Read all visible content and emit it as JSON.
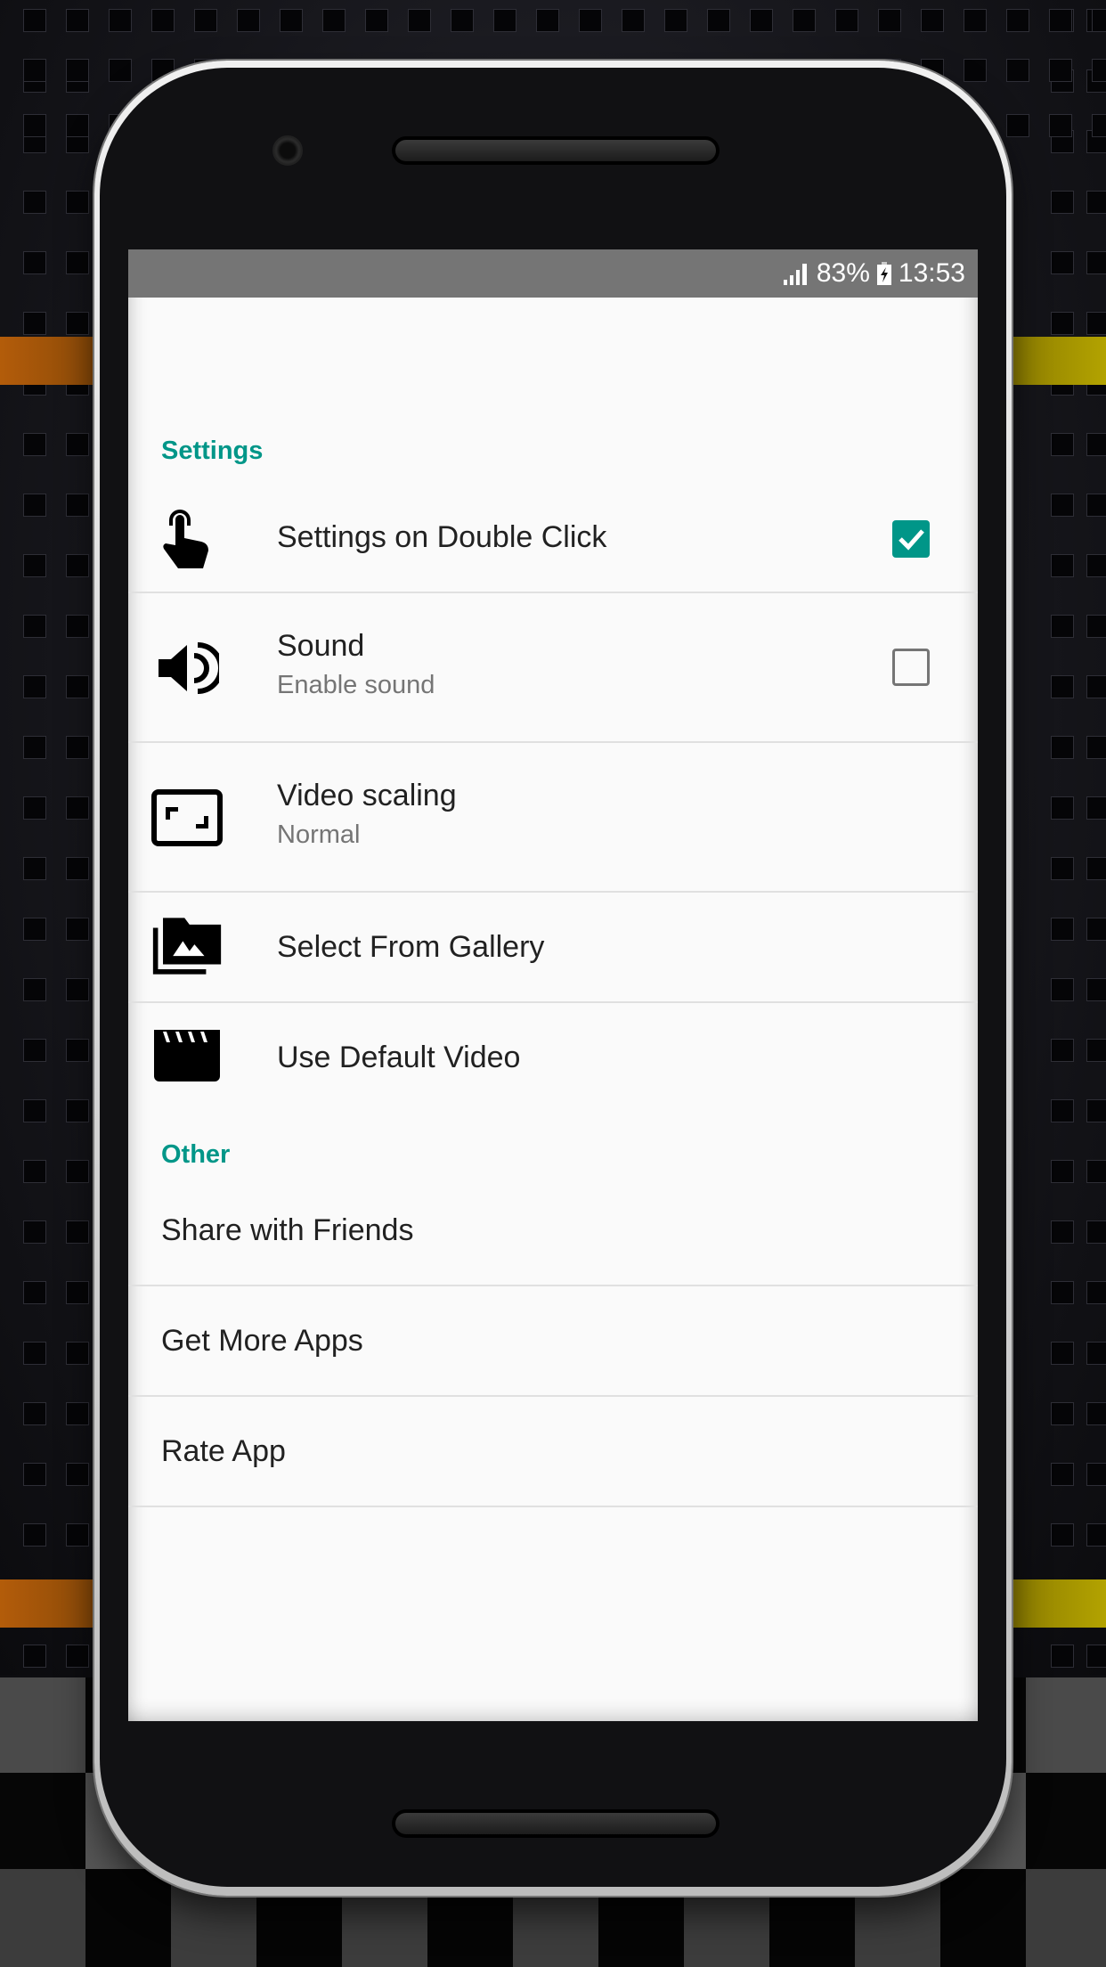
{
  "status_bar": {
    "signal_icon": "cellular-signal-icon",
    "battery_percent": "83%",
    "battery_icon": "battery-charging-icon",
    "time": "13:53"
  },
  "settings_section": {
    "header": "Settings",
    "items": [
      {
        "title": "Settings on Double Click",
        "icon": "touch-gesture-icon",
        "control": "checkbox",
        "checked": true
      },
      {
        "title": "Sound",
        "summary": "Enable sound",
        "icon": "volume-up-icon",
        "control": "checkbox",
        "checked": false
      },
      {
        "title": "Video scaling",
        "summary": "Normal",
        "icon": "aspect-ratio-icon"
      },
      {
        "title": "Select From Gallery",
        "icon": "photo-library-icon"
      },
      {
        "title": "Use Default Video",
        "icon": "movie-clapperboard-icon"
      }
    ]
  },
  "other_section": {
    "header": "Other",
    "items": [
      {
        "title": "Share with Friends"
      },
      {
        "title": "Get More Apps"
      },
      {
        "title": "Rate App"
      }
    ]
  },
  "colors": {
    "accent": "#009688",
    "status_bar": "#757575",
    "background": "#fafafa",
    "primary_text": "#212121",
    "secondary_text": "#757575"
  }
}
